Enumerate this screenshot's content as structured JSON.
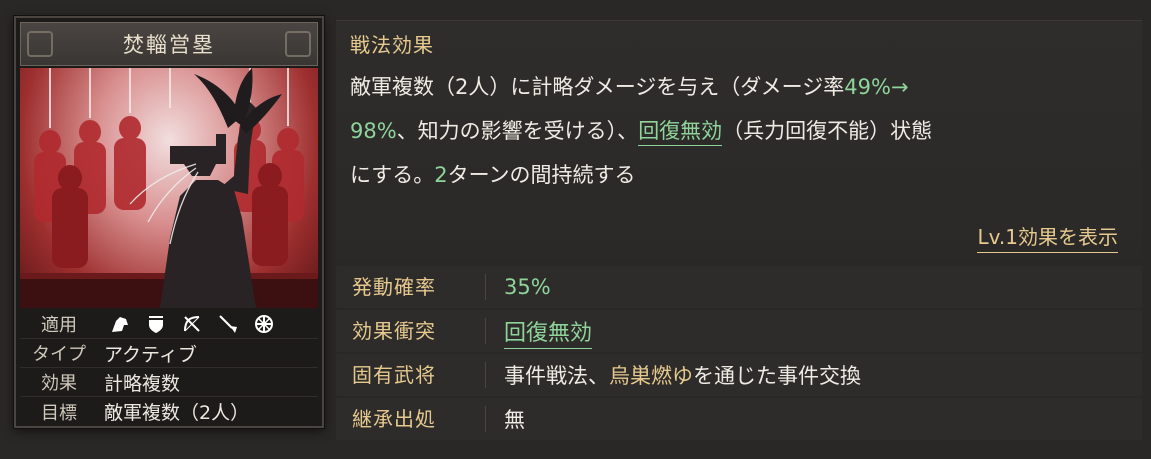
{
  "card": {
    "title": "焚輜営塁",
    "meta": {
      "apply_label": "適用",
      "apply_icons": [
        "cavalry-icon",
        "shield-icon",
        "bow-icon",
        "spear-icon",
        "wheel-icon"
      ],
      "type_label": "タイプ",
      "type_value": "アクティブ",
      "effect_label": "効果",
      "effect_value": "計略複数",
      "target_label": "目標",
      "target_value": "敵軍複数（2人）"
    }
  },
  "effect": {
    "title": "戦法効果",
    "text_1": "敵軍複数（2人）に計略ダメージを与え（ダメージ率",
    "rate_from": "49%→",
    "rate_to": "98%",
    "text_2": "、知力の影響を受ける）、",
    "status_link": "回復無効",
    "text_3": "（兵力回復不能）状態",
    "text_4": "にする。",
    "turns": "2",
    "text_5": "ターンの間持続する",
    "level_link": "Lv.1効果を表示"
  },
  "rows": {
    "trigger_label": "発動確率",
    "trigger_value": "35%",
    "conflict_label": "効果衝突",
    "conflict_value": "回復無効",
    "unique_label": "固有武将",
    "unique_prefix": "事件戦法、",
    "unique_event": "烏巣燃ゆ",
    "unique_suffix": "を通じた事件交換",
    "inherit_label": "継承出処",
    "inherit_value": "無"
  },
  "colors": {
    "gold": "#e6c98f",
    "green": "#8fd49a",
    "art_red": "#9e2f2f"
  }
}
